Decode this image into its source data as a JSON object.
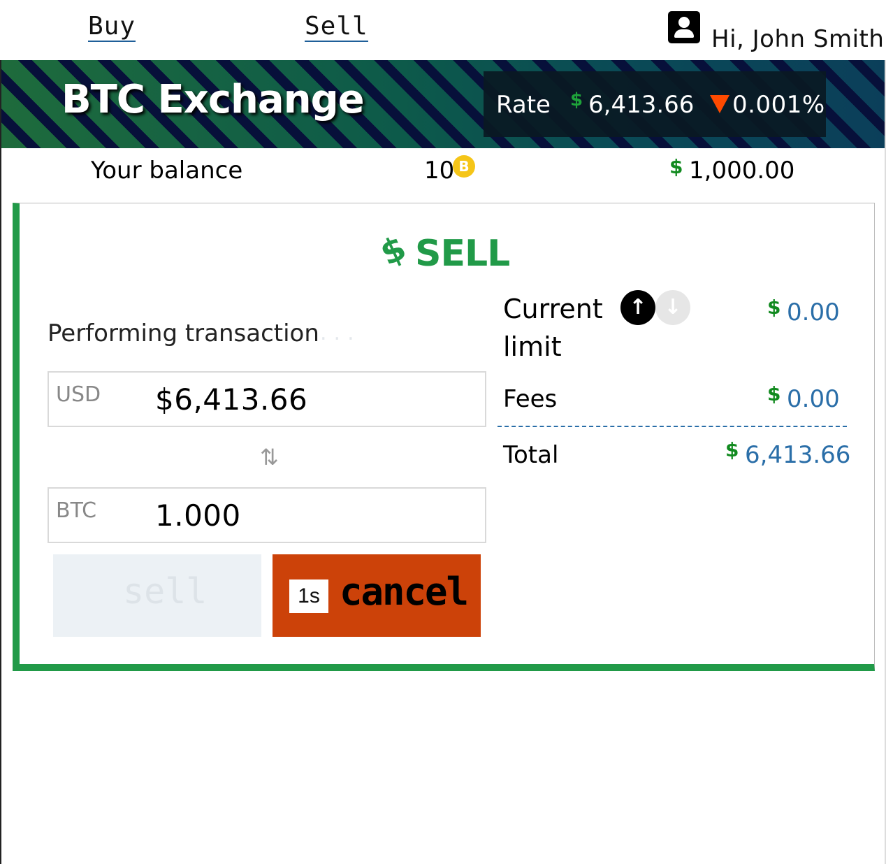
{
  "nav": {
    "buy_label": "Buy",
    "sell_label": "Sell",
    "greeting": "Hi, John Smith",
    "user_icon": "user-icon"
  },
  "banner": {
    "brand": "BTC Exchange",
    "rate_label": "Rate",
    "rate_currency": "$",
    "rate_value": "6,413.66",
    "rate_direction": "down",
    "rate_change": "0.001%"
  },
  "balance": {
    "label": "Your balance",
    "btc_amount": "10",
    "btc_icon": "B",
    "usd_currency": "$",
    "usd_amount": "1,000.00"
  },
  "panel": {
    "title_icon": "$",
    "title": "SELL",
    "status_text": "Performing transaction",
    "status_dots": "...",
    "usd_field": {
      "label": "USD",
      "value": "$6,413.66"
    },
    "swap_icon": "⇅",
    "btc_field": {
      "label": "BTC",
      "value": "1.000"
    },
    "sell_button": "sell",
    "cancel_timer": "1s",
    "cancel_button": "cancel"
  },
  "summary": {
    "limit_label": "Current limit",
    "limit_currency": "$",
    "limit_value": "0.00",
    "fees_label": "Fees",
    "fees_currency": "$",
    "fees_value": "0.00",
    "total_label": "Total",
    "total_currency": "$",
    "total_value": "6,413.66"
  },
  "colors": {
    "accent_green": "#219a48",
    "cancel_orange": "#cc4209",
    "down_arrow": "#ff4a00",
    "value_blue": "#2a6ea8"
  }
}
